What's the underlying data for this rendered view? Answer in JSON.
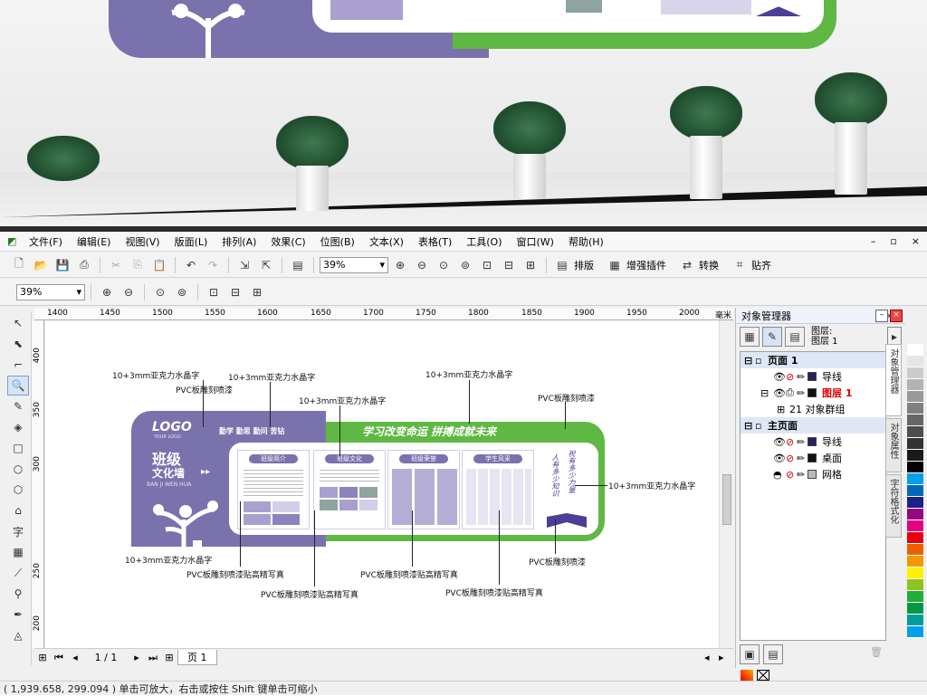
{
  "menu": [
    "文件(F)",
    "编辑(E)",
    "视图(V)",
    "版面(L)",
    "排列(A)",
    "效果(C)",
    "位图(B)",
    "文本(X)",
    "表格(T)",
    "工具(O)",
    "窗口(W)",
    "帮助(H)"
  ],
  "toolbar": {
    "zoom": "39%",
    "tools": [
      "排版",
      "增强插件",
      "转换",
      "贴齐"
    ]
  },
  "propbar": {
    "zoom": "39%"
  },
  "ruler_h": [
    "1400",
    "1450",
    "1500",
    "1550",
    "1600",
    "1650",
    "1700",
    "1750",
    "1800",
    "1850",
    "1900",
    "1950",
    "2000",
    "毫米"
  ],
  "ruler_v": [
    "400",
    "350",
    "300",
    "250",
    "200"
  ],
  "design": {
    "logo": "LOGO",
    "logo_sub": "YOUR LOGO",
    "motto": "勤学 勤思 勤问 苦钻",
    "title1": "班级",
    "title2": "文化墙",
    "pinyin": "BAN JI WEN HUA",
    "banner": "学习改变命运 拼搏成就未来",
    "sections": [
      "班级简介",
      "班级文化",
      "班级荣誉",
      "学生风采"
    ],
    "poem1": "祝有多少力量",
    "poem2": "人有多少知识",
    "annotations": {
      "a1": "10+3mm亚克力水晶字",
      "a2": "PVC板雕刻喷漆",
      "a3": "10+3mm亚克力水晶字",
      "a4": "10+3mm亚克力水晶字",
      "a5": "10+3mm亚克力水晶字",
      "a6": "PVC板雕刻喷漆",
      "a7": "10+3mm亚克力水晶字",
      "a8": "10+3mm亚克力水晶字",
      "a9": "PVC板雕刻喷漆贴高精写真",
      "a10": "PVC板雕刻喷漆贴高精写真",
      "a11": "PVC板雕刻喷漆贴高精写真",
      "a12": "PVC板雕刻喷漆贴高精写真",
      "a13": "PVC板雕刻喷漆"
    }
  },
  "pager": {
    "counter": "1 / 1",
    "tab": "页 1"
  },
  "object_manager": {
    "title": "对象管理器",
    "layer_label": "图层:",
    "layer_value": "图层 1",
    "rows": [
      {
        "type": "page",
        "label": "页面 1",
        "sw": ""
      },
      {
        "type": "layer",
        "label": "导线",
        "sw": "#2a2060"
      },
      {
        "type": "layer",
        "label": "图层 1",
        "sw": "#111111",
        "red": true
      },
      {
        "type": "object",
        "label": "21 对象群组",
        "sw": ""
      },
      {
        "type": "page",
        "label": "主页面",
        "sw": ""
      },
      {
        "type": "layer",
        "label": "导线",
        "sw": "#2a2060"
      },
      {
        "type": "layer",
        "label": "桌面",
        "sw": "#111111"
      },
      {
        "type": "layer",
        "label": "网格",
        "sw": "#bbbbbb"
      }
    ]
  },
  "side_tabs": [
    "对象管理器",
    "对象属性",
    "字符格式化"
  ],
  "palette": [
    "#ffffff",
    "#e6e6e6",
    "#cccccc",
    "#b3b3b3",
    "#999999",
    "#808080",
    "#666666",
    "#4d4d4d",
    "#333333",
    "#1a1a1a",
    "#000000",
    "#00a0e9",
    "#0068b7",
    "#1d2088",
    "#920783",
    "#e4007f",
    "#e60012",
    "#eb6100",
    "#f39800",
    "#fff100",
    "#8fc31f",
    "#22ac38",
    "#009944",
    "#009e96",
    "#00a0e9"
  ],
  "status": "( 1,939.658, 299.094 ) 单击可放大，右击或按住 Shift 键单击可缩小",
  "colors": {
    "purple": "#7a72ac",
    "green": "#5fb843",
    "accent": "#4b3f97"
  }
}
